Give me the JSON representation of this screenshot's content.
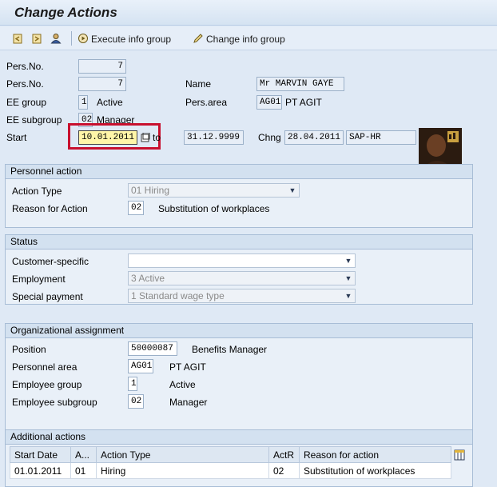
{
  "title": "Change Actions",
  "toolbar": {
    "execute_label": "Execute info group",
    "change_label": "Change info group"
  },
  "header": {
    "pers_no_label_1": "Pers.No.",
    "pers_no_value_1": "7",
    "pers_no_label_2": "Pers.No.",
    "pers_no_value_2": "7",
    "name_label": "Name",
    "name_value": "Mr MARVIN GAYE",
    "ee_group_label": "EE group",
    "ee_group_code": "1",
    "ee_group_text": "Active",
    "pers_area_label": "Pers.area",
    "pers_area_code": "AG01",
    "pers_area_text": "PT AGIT",
    "ee_subgroup_label": "EE subgroup",
    "ee_subgroup_code": "02",
    "ee_subgroup_text": "Manager",
    "start_label": "Start",
    "start_value": "10.01.2011",
    "to_label": "to",
    "end_value": "31.12.9999",
    "chng_label": "Chng",
    "chng_date": "28.04.2011",
    "chng_user": "SAP-HR"
  },
  "personnel_action": {
    "title": "Personnel action",
    "action_type_label": "Action Type",
    "action_type_value": "01 Hiring",
    "reason_label": "Reason for Action",
    "reason_code": "02",
    "reason_text": "Substitution of workplaces"
  },
  "status": {
    "title": "Status",
    "customer_label": "Customer-specific",
    "customer_value": "",
    "employment_label": "Employment",
    "employment_value": "3 Active",
    "special_label": "Special payment",
    "special_value": "1 Standard wage type"
  },
  "org": {
    "title": "Organizational assignment",
    "position_label": "Position",
    "position_code": "50000087",
    "position_text": "Benefits Manager",
    "pers_area_label": "Personnel area",
    "pers_area_code": "AG01",
    "pers_area_text": "PT AGIT",
    "emp_group_label": "Employee group",
    "emp_group_code": "1",
    "emp_group_text": "Active",
    "emp_subgroup_label": "Employee subgroup",
    "emp_subgroup_code": "02",
    "emp_subgroup_text": "Manager"
  },
  "additional": {
    "title": "Additional actions",
    "columns": [
      "Start Date",
      "A...",
      "Action Type",
      "ActR",
      "Reason for action"
    ],
    "rows": [
      [
        "01.01.2011",
        "01",
        "Hiring",
        "02",
        "Substitution of workplaces"
      ]
    ]
  },
  "colors": {
    "highlight": "#c8102e",
    "active_field": "#fff5a8"
  }
}
